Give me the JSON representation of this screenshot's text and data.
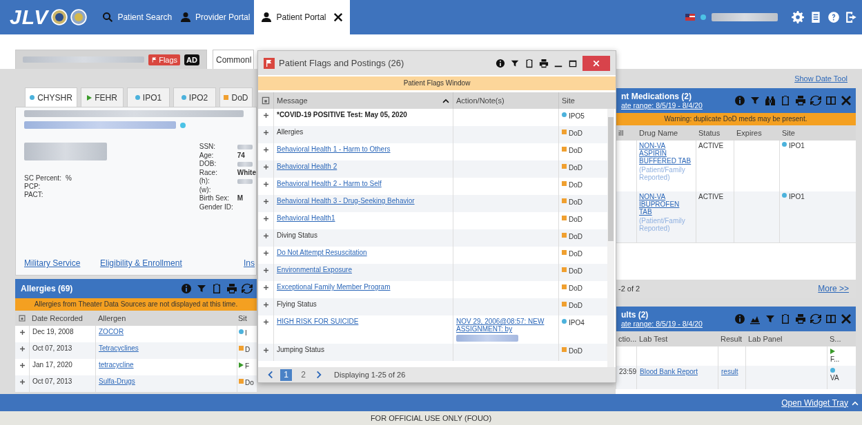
{
  "app": {
    "logo": "JLV"
  },
  "nav": [
    {
      "label": "Patient Search",
      "selected": false
    },
    {
      "label": "Provider Portal",
      "selected": false
    },
    {
      "label": "Patient Portal",
      "selected": true
    }
  ],
  "header_tabs": [
    {
      "kind": "patient",
      "flags": "Flags",
      "badge": "AD",
      "selected": true
    },
    {
      "kind": "label",
      "label": "Commonl",
      "selected": false
    }
  ],
  "show_date_tool": "Show Date Tool",
  "demographics": {
    "site_tabs": [
      {
        "label": "CHYSHR",
        "kind": "circle",
        "color": "#4cb2dc",
        "selected": true
      },
      {
        "label": "FEHR",
        "kind": "triangle",
        "color": "#3a9a2a",
        "selected": false
      },
      {
        "label": "IPO1",
        "kind": "circle",
        "color": "#4cb2dc",
        "selected": false
      },
      {
        "label": "IPO2",
        "kind": "circle",
        "color": "#4cb2dc",
        "selected": false
      },
      {
        "label": "DoD",
        "kind": "square",
        "color": "#f0a030",
        "selected": false
      }
    ],
    "left_fields": [
      {
        "label": "SC Percent:",
        "value": "%"
      },
      {
        "label": "PCP:"
      },
      {
        "label": "PACT:"
      }
    ],
    "right_fields": [
      {
        "label": "SSN:",
        "redacted": true
      },
      {
        "label": "Age:",
        "value": "74",
        "redacted": false
      },
      {
        "label": "DOB:",
        "redacted": true
      },
      {
        "label": "Race:",
        "value": "White",
        "redacted": false
      },
      {
        "label": "(h):",
        "redacted": true
      },
      {
        "label": "(w):",
        "redacted": false
      },
      {
        "label": "Birth Sex:",
        "value": "M",
        "redacted": false
      },
      {
        "label": "Gender ID:",
        "redacted": false
      }
    ],
    "links": [
      "Military Service",
      "Eligibility & Enrollment",
      "Ins"
    ]
  },
  "allergies": {
    "title": "Allergies (69)",
    "banner": "Allergies from Theater Data Sources are not displayed at this time.",
    "columns": [
      "Date Recorded",
      "Allergen",
      "Sit"
    ],
    "rows": [
      {
        "date": "Dec 19, 2008",
        "allergen": "ZOCOR",
        "site": {
          "label": "I",
          "kind": "circle",
          "color": "#4cb2dc"
        }
      },
      {
        "date": "Oct 07, 2013",
        "allergen": "Tetracyclines",
        "site": {
          "label": "D",
          "kind": "square",
          "color": "#f0a030"
        }
      },
      {
        "date": "Jan 17, 2020",
        "allergen": "tetracycline",
        "site": {
          "label": "F",
          "kind": "triangle",
          "color": "#3a9a2a"
        }
      },
      {
        "date": "Oct 07, 2013",
        "allergen": "Sulfa-Drugs",
        "site": {
          "label": "Do",
          "kind": "square",
          "color": "#f0a030"
        }
      }
    ]
  },
  "medications": {
    "title": "nt Medications (2)",
    "date_range": "ate range: 8/5/19 - 8/4/20",
    "warning": "Warning: duplicate DoD meds may be present.",
    "columns": [
      "ill",
      "Drug Name",
      "Status",
      "Expires",
      "Site"
    ],
    "rows": [
      {
        "drug": "NON-VA ASPIRIN BUFFERED TAB",
        "note": "(Patient/Family Reported)",
        "status": "ACTIVE",
        "site": {
          "label": "IPO1",
          "kind": "circle",
          "color": "#4cb2dc"
        }
      },
      {
        "drug": "NON-VA IBUPROFEN TAB",
        "note": "(Patient/Family Reported)",
        "status": "ACTIVE",
        "site": {
          "label": "IPO1",
          "kind": "circle",
          "color": "#4cb2dc"
        }
      }
    ],
    "footer": "-2 of 2",
    "more": "More >>"
  },
  "labs": {
    "title": "ults (2)",
    "date_range": "ate range: 8/5/19 - 8/4/20",
    "columns": [
      "ctio...",
      "Lab Test",
      "Result",
      "Lab Panel",
      "S..."
    ],
    "rows": [
      {
        "site": {
          "label": "F...",
          "kind": "triangle",
          "color": "#3a9a2a"
        }
      },
      {
        "collected": "23:59",
        "test": "Blood Bank Report",
        "result": "result",
        "site": {
          "label": "VA",
          "kind": "circle",
          "color": "#4cb2dc"
        }
      }
    ]
  },
  "flags_window": {
    "title": "Patient Flags and Postings (26)",
    "banner": "Patient Flags Window",
    "columns": [
      {
        "label": "Message",
        "sorted": true
      },
      {
        "label": "Action/Note(s)",
        "sorted": false
      },
      {
        "label": "Site",
        "sorted": false
      }
    ],
    "rows": [
      {
        "message": "*COVID-19 POSITIVE Test: May 05, 2020",
        "link": false,
        "bold": true,
        "site": {
          "label": "IPO5",
          "kind": "circle",
          "color": "#4cb2dc"
        }
      },
      {
        "message": "Allergies",
        "link": false,
        "bold": false,
        "site": {
          "label": "DoD",
          "kind": "square",
          "color": "#f0a030"
        }
      },
      {
        "message": "Behavioral Health 1 - Harm to Others",
        "link": true,
        "bold": false,
        "site": {
          "label": "DoD",
          "kind": "square",
          "color": "#f0a030"
        }
      },
      {
        "message": "Behavioral Health 2",
        "link": true,
        "bold": false,
        "site": {
          "label": "DoD",
          "kind": "square",
          "color": "#f0a030"
        }
      },
      {
        "message": "Behavioral Health 2 - Harm to Self",
        "link": true,
        "bold": false,
        "site": {
          "label": "DoD",
          "kind": "square",
          "color": "#f0a030"
        }
      },
      {
        "message": "Behavioral Health 3 - Drug-Seeking Behavior",
        "link": true,
        "bold": false,
        "site": {
          "label": "DoD",
          "kind": "square",
          "color": "#f0a030"
        }
      },
      {
        "message": "Behavioral Health1",
        "link": true,
        "bold": false,
        "site": {
          "label": "DoD",
          "kind": "square",
          "color": "#f0a030"
        }
      },
      {
        "message": "Diving Status",
        "link": false,
        "bold": false,
        "site": {
          "label": "DoD",
          "kind": "square",
          "color": "#f0a030"
        }
      },
      {
        "message": "Do Not Attempt Resuscitation",
        "link": true,
        "bold": false,
        "site": {
          "label": "DoD",
          "kind": "square",
          "color": "#f0a030"
        }
      },
      {
        "message": "Environmental Exposure",
        "link": true,
        "bold": false,
        "site": {
          "label": "DoD",
          "kind": "square",
          "color": "#f0a030"
        }
      },
      {
        "message": "Exceptional Family Member Program",
        "link": true,
        "bold": false,
        "site": {
          "label": "DoD",
          "kind": "square",
          "color": "#f0a030"
        }
      },
      {
        "message": "Flying Status",
        "link": false,
        "bold": false,
        "site": {
          "label": "DoD",
          "kind": "square",
          "color": "#f0a030"
        }
      },
      {
        "message": "HIGH RISK FOR SUICIDE",
        "link": true,
        "bold": false,
        "note": "NOV 29, 2006@08:57: NEW ASSIGNMENT: by",
        "site": {
          "label": "IPO4",
          "kind": "circle",
          "color": "#4cb2dc"
        }
      },
      {
        "message": "Jumping Status",
        "link": false,
        "bold": false,
        "site": {
          "label": "DoD",
          "kind": "square",
          "color": "#f0a030"
        }
      }
    ],
    "pages": [
      {
        "label": "1",
        "selected": true
      },
      {
        "label": "2",
        "selected": false
      }
    ],
    "summary": "Displaying 1-25 of 26"
  },
  "widget_tray": "Open Widget Tray",
  "footer": "FOR OFFICIAL USE ONLY (FOUO)"
}
